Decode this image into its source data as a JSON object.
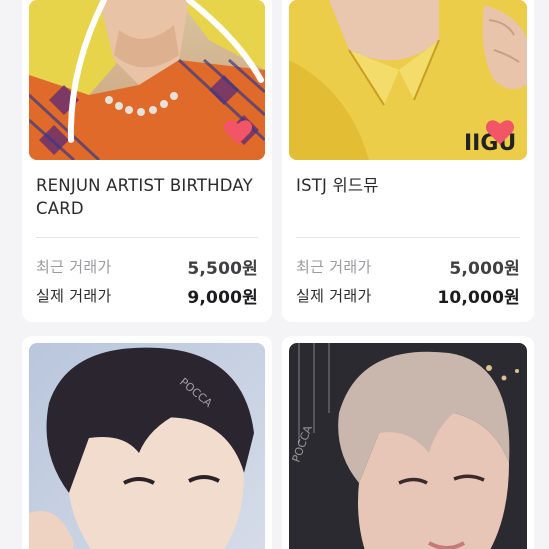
{
  "products": [
    {
      "title": "RENJUN ARTIST BIRTHDAY CARD",
      "recent_label": "최근 거래가",
      "recent_price": "5,500원",
      "actual_label": "실제 거래가",
      "actual_price": "9,000원",
      "liked": true
    },
    {
      "title": "ISTJ 위드뮤",
      "recent_label": "최근 거래가",
      "recent_price": "5,000원",
      "actual_label": "실제 거래가",
      "actual_price": "10,000원",
      "liked": true
    },
    {
      "title": "",
      "liked": false
    },
    {
      "title": "",
      "liked": false
    }
  ],
  "colors": {
    "heart": "#f25566",
    "background": "#f4f4f6",
    "card": "#ffffff"
  },
  "icons": {
    "like": "heart-icon"
  }
}
